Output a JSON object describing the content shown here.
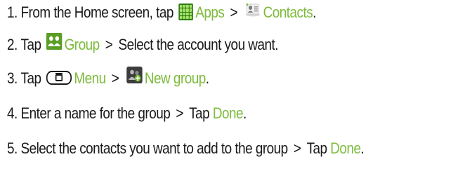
{
  "steps": [
    {
      "num": "1.",
      "parts": [
        "From the Home screen, tap",
        "Apps",
        ">",
        "Contacts",
        "."
      ]
    },
    {
      "num": "2.",
      "parts": [
        "Tap",
        "Group",
        ">",
        "Select the account you want."
      ]
    },
    {
      "num": "3.",
      "parts": [
        "Tap",
        "Menu",
        ">",
        "New group",
        "."
      ]
    },
    {
      "num": "4.",
      "parts": [
        "Enter a name for the group",
        ">",
        "Tap",
        "Done",
        "."
      ]
    },
    {
      "num": "5.",
      "parts": [
        "Select the contacts you want to add to the group",
        ">",
        "Tap",
        "Done",
        "."
      ]
    }
  ],
  "icons": {
    "apps": "apps-grid-icon",
    "contacts": "contacts-icon",
    "group": "group-icon",
    "menu": "menu-key-icon",
    "new_group": "new-group-icon"
  },
  "colors": {
    "text": "#1a1a1a",
    "highlight": "#7dbb3c",
    "background": "#ffffff"
  }
}
